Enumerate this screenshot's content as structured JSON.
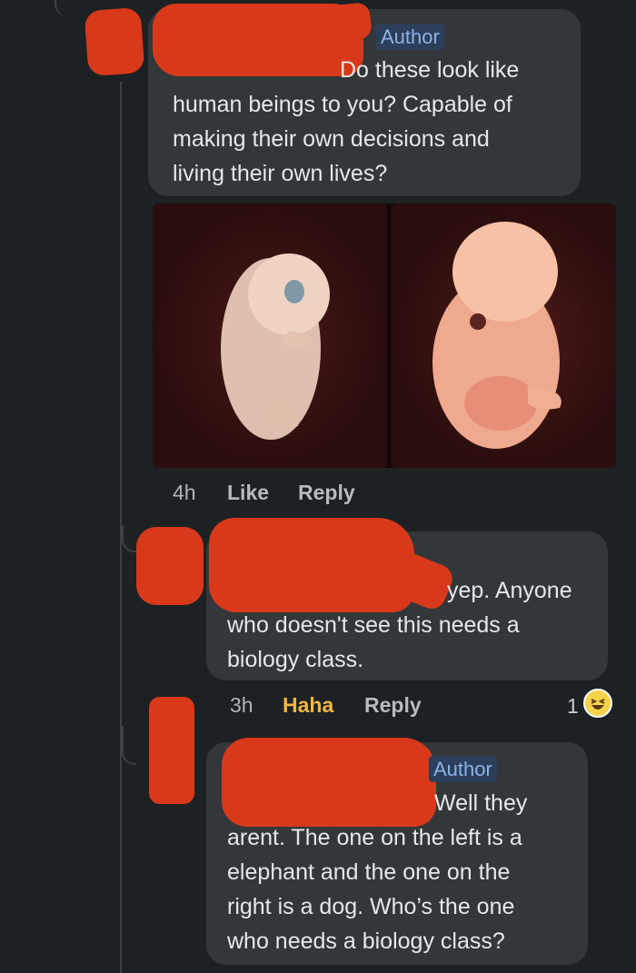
{
  "comments": [
    {
      "author_badge": "Author",
      "text_first": "Do these look like",
      "text_rest": "human beings to you? Capable of\nmaking their own decisions and\nliving their own lives?",
      "time": "4h",
      "actions": [
        "Like",
        "Reply"
      ]
    },
    {
      "text_first": "yep. Anyone",
      "text_rest": "who doesn't see this needs a\nbiology class.",
      "time": "3h",
      "actions": [
        "Haha",
        "Reply"
      ],
      "reaction_count": "1",
      "reaction_icon": "haha-emoji-icon"
    },
    {
      "author_badge": "Author",
      "text_first": "Well they",
      "text_rest": "arent. The one on the left is a\nelephant and the one on the\nright is a dog. Who’s the one\nwho needs a biology class?"
    }
  ],
  "colors": {
    "background": "#1d2123",
    "bubble": "#33373a",
    "redaction": "#d8391a",
    "author_badge_bg": "#2b3e5a",
    "author_badge_text": "#8cb2e6",
    "haha": "#f2b640"
  }
}
